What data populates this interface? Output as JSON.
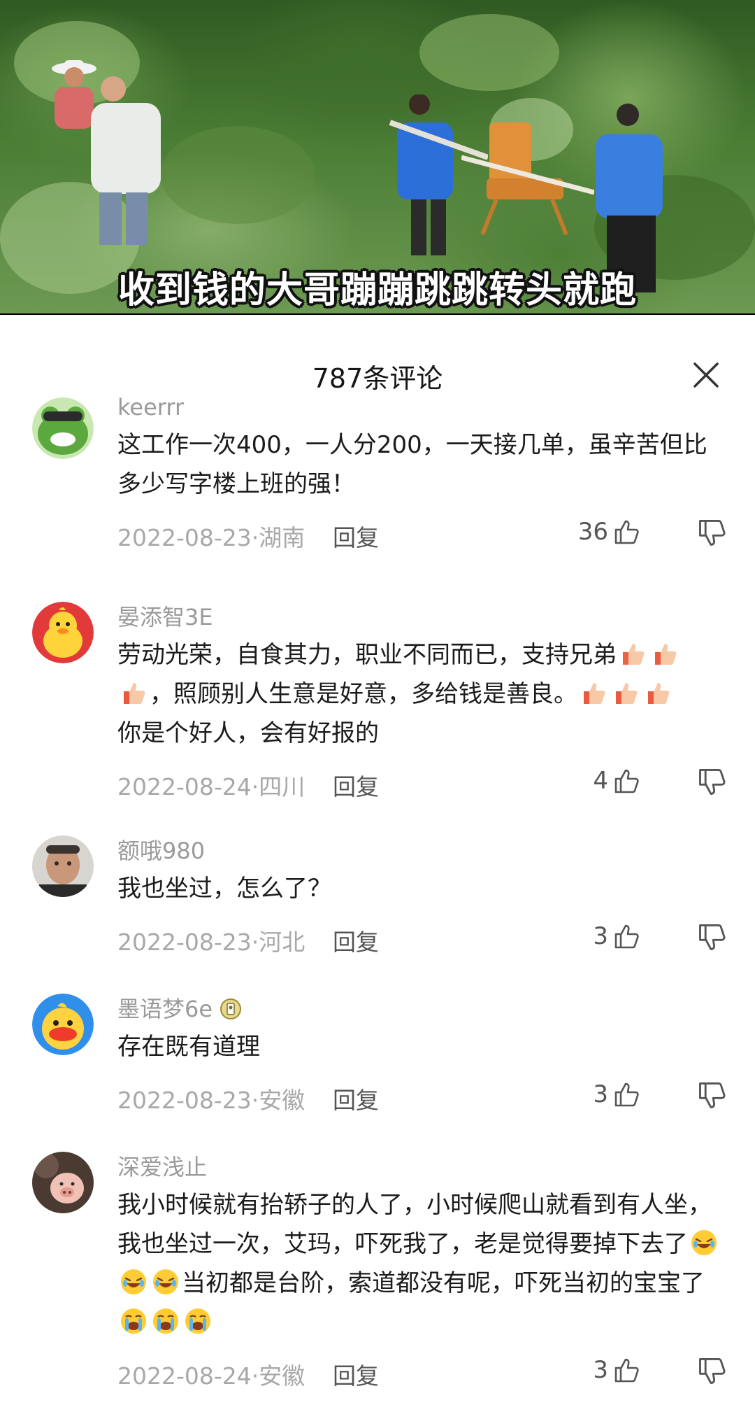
{
  "video": {
    "subtitle": "收到钱的大哥蹦蹦跳跳转头就跑"
  },
  "sheet": {
    "title": "787条评论"
  },
  "comments": [
    {
      "username": "keerrr",
      "text": "这工作一次400，一人分200，一天接几单，虽辛苦但比多少写字楼上班的强！",
      "date": "2022-08-23·湖南",
      "reply_label": "回复",
      "likes": "36",
      "avatar_icon": "frog-avatar-icon"
    },
    {
      "username": "晏添智3E",
      "text_part1": "劳动光荣，自食其力，职业不同而已，支持兄弟",
      "text_part2": "，照顾别人生意是好意，多给钱是善良。",
      "text_part3": "你是个好人，会有好报的",
      "date": "2022-08-24·四川",
      "reply_label": "回复",
      "likes": "4",
      "avatar_icon": "duck-avatar-icon",
      "emoji_icon": "thumbs-up-emoji"
    },
    {
      "username": "额哦980",
      "text": "我也坐过，怎么了？",
      "date": "2022-08-23·河北",
      "reply_label": "回复",
      "likes": "3",
      "avatar_icon": "man-photo-avatar"
    },
    {
      "username": "墨语梦6e",
      "text": "存在既有道理",
      "date": "2022-08-23·安徽",
      "reply_label": "回复",
      "likes": "3",
      "avatar_icon": "yellow-bird-avatar-icon",
      "badge_icon": "user-badge-icon"
    },
    {
      "username": "深爱浅止",
      "text_part1": "我小时候就有抬轿子的人了，小时候爬山就看到有人坐，我也坐过一次，艾玛，吓死我了，老是觉得要掉下去了",
      "text_part2": "当初都是台阶，索道都没有呢，吓死当初的宝宝了",
      "date": "2022-08-24·安徽",
      "reply_label": "回复",
      "likes": "3",
      "avatar_icon": "pig-photo-avatar",
      "emoji_icons": [
        "rofl-emoji",
        "crying-emoji"
      ]
    }
  ],
  "colors": {
    "meta_text": "#a8a8a8",
    "username": "#9a9a9a",
    "body_text": "#1b1b1b"
  }
}
